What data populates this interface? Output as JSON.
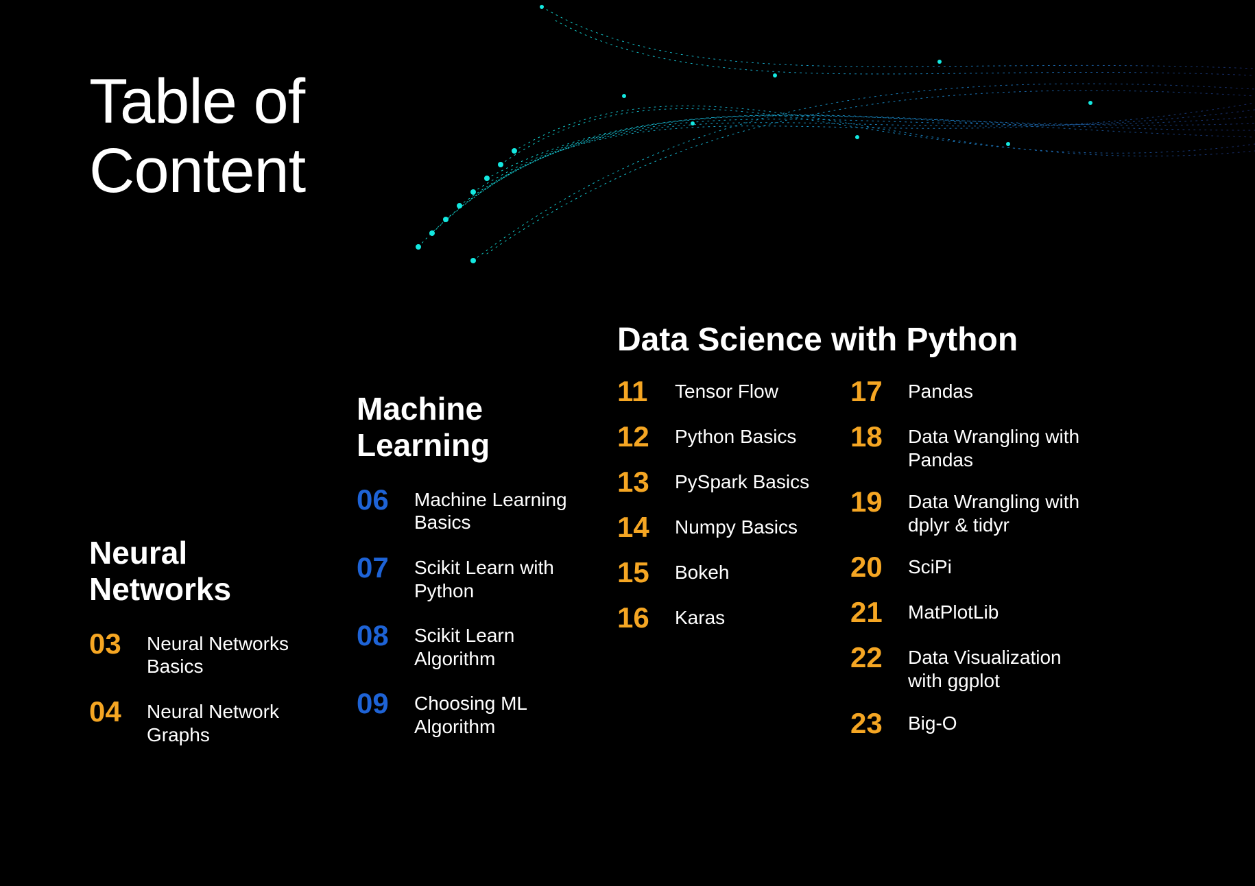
{
  "title_line1": "Table of",
  "title_line2": "Content",
  "sections": {
    "neural_networks": {
      "heading": "Neural Networks",
      "items": [
        {
          "num": "03",
          "label": "Neural Networks Basics"
        },
        {
          "num": "04",
          "label": "Neural Network Graphs"
        }
      ]
    },
    "machine_learning": {
      "heading": "Machine Learning",
      "items": [
        {
          "num": "06",
          "label": "Machine Learning Basics"
        },
        {
          "num": "07",
          "label": "Scikit Learn with Python"
        },
        {
          "num": "08",
          "label": "Scikit Learn Algorithm"
        },
        {
          "num": "09",
          "label": "Choosing ML Algorithm"
        }
      ]
    },
    "data_science": {
      "heading": "Data Science with Python",
      "col_a": [
        {
          "num": "11",
          "label": "Tensor Flow"
        },
        {
          "num": "12",
          "label": "Python Basics"
        },
        {
          "num": "13",
          "label": "PySpark Basics"
        },
        {
          "num": "14",
          "label": "Numpy Basics"
        },
        {
          "num": "15",
          "label": "Bokeh"
        },
        {
          "num": "16",
          "label": "Karas"
        }
      ],
      "col_b": [
        {
          "num": "17",
          "label": "Pandas"
        },
        {
          "num": "18",
          "label": "Data Wrangling with Pandas"
        },
        {
          "num": "19",
          "label": "Data Wrangling with dplyr & tidyr"
        },
        {
          "num": "20",
          "label": "SciPi"
        },
        {
          "num": "21",
          "label": "MatPlotLib"
        },
        {
          "num": "22",
          "label": "Data Visualization with ggplot"
        },
        {
          "num": "23",
          "label": "Big-O"
        }
      ]
    }
  },
  "colors": {
    "accent_yellow": "#f5a623",
    "accent_blue": "#1e63d6",
    "accent_orange": "#f5a623"
  }
}
